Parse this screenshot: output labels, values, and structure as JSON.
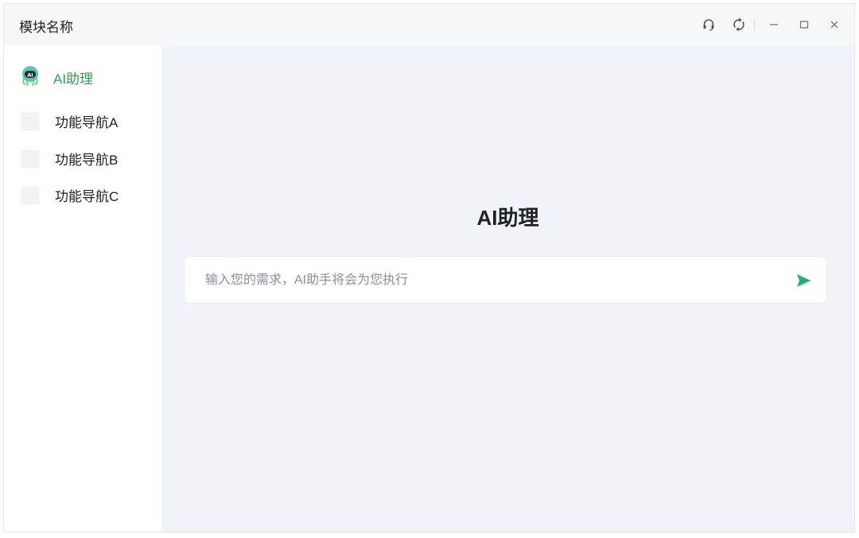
{
  "window": {
    "title": "模块名称"
  },
  "titlebar_icons": [
    "headset-icon",
    "refresh-icon",
    "minimize-icon",
    "maximize-icon",
    "close-icon"
  ],
  "sidebar": {
    "items": [
      {
        "label": "AI助理",
        "icon": "ai-robot-icon",
        "active": true
      },
      {
        "label": "功能导航A",
        "icon": "placeholder-icon",
        "active": false
      },
      {
        "label": "功能导航B",
        "icon": "placeholder-icon",
        "active": false
      },
      {
        "label": "功能导航C",
        "icon": "placeholder-icon",
        "active": false
      }
    ]
  },
  "main": {
    "title": "AI助理",
    "input": {
      "placeholder": "输入您的需求，AI助手将会为您执行",
      "value": ""
    },
    "send_icon": "send-icon"
  },
  "colors": {
    "accent": "#1fa84a",
    "send": "#22b573",
    "main_bg": "#f0f3f7",
    "titlebar_bg": "#f6f7f9"
  }
}
